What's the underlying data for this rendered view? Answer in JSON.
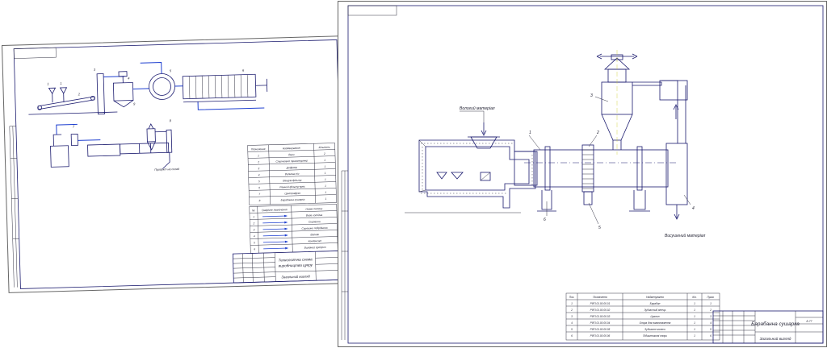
{
  "left_sheet": {
    "title_block": {
      "title_line1": "Технологічна схема",
      "title_line2": "виробництва цукру",
      "subtitle": "Загальний вигляд"
    },
    "callouts": [
      "1",
      "2",
      "3",
      "4",
      "5",
      "6",
      "7",
      "8",
      "9"
    ],
    "caption": "Продукт на склад",
    "equipment_table": {
      "headers": [
        "Позначення",
        "Найменування",
        "Кількість"
      ],
      "rows": [
        [
          "1",
          "Ваги",
          "2"
        ],
        [
          "2",
          "Стрічковий транспортер",
          "1"
        ],
        [
          "3",
          "Дифузор",
          "1"
        ],
        [
          "4",
          "Вапняна піч",
          "1"
        ],
        [
          "5",
          "Вакуум-фільтр",
          "1"
        ],
        [
          "6",
          "Рамний фільтр-прес",
          "1"
        ],
        [
          "7",
          "Центрифуга",
          "1"
        ],
        [
          "8",
          "Барабанна сушарка",
          "1"
        ]
      ]
    },
    "flow_table": {
      "headers": [
        "№",
        "Графічне позначення",
        "Назва потоку"
      ],
      "rows": [
        [
          "1",
          "",
          "Вода холодна"
        ],
        [
          "2",
          "",
          "Сировина"
        ],
        [
          "3",
          "",
          "Сировина подрібнена"
        ],
        [
          "4",
          "",
          "Вапняк"
        ],
        [
          "5",
          "",
          "Конденсат"
        ],
        [
          "6",
          "",
          "Вихідний продукт"
        ]
      ]
    }
  },
  "right_sheet": {
    "labels": {
      "input": "Вологий матеріал",
      "output": "Висушений матеріал"
    },
    "callouts": [
      "1",
      "2",
      "3",
      "4",
      "5",
      "6"
    ],
    "parts_table": {
      "headers": [
        "Поз.",
        "Позначення",
        "Найменування",
        "Кіл.",
        "Прим."
      ],
      "rows": [
        [
          "1",
          "РФП.01.00.00.01",
          "Барабан",
          "1",
          "1"
        ],
        [
          "2",
          "РФП.01.00.00.02",
          "Зубчастий вінець",
          "1",
          "2"
        ],
        [
          "3",
          "РФП.01.00.00.03",
          "Циклон",
          "1",
          "3"
        ],
        [
          "4",
          "РФП.01.00.00.04",
          "Опора для вивантаження",
          "1",
          "4"
        ],
        [
          "5",
          "РФП.01.00.00.05",
          "Зубчасте колесо",
          "1",
          "5"
        ],
        [
          "6",
          "РФП.01.00.00.06",
          "Підшипникові опори",
          "1",
          "6"
        ]
      ]
    },
    "title_block": {
      "title": "Барабанна сушарка",
      "subtitle": "Загальний вигляд",
      "sheet_code": "Б-77"
    }
  },
  "colors": {
    "line": "#1a1a6e",
    "flow": "#1e3fd0",
    "paper": "#ffffff",
    "frame": "#3a3a8a"
  }
}
